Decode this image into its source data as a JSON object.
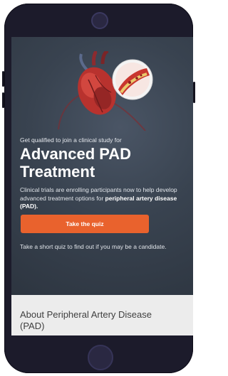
{
  "hero": {
    "eyebrow": "Get qualified to join a clinical study for",
    "title": "Advanced PAD Treatment",
    "description_prefix": "Clinical trials are enrolling participants now to help develop advanced treatment options for ",
    "description_bold": "peripheral artery disease (PAD).",
    "cta_label": "Take the quiz",
    "note": "Take a short quiz to find out if you may be a candidate."
  },
  "about": {
    "heading": "About Peripheral Artery Disease (PAD)"
  },
  "colors": {
    "hero_bg": "#394350",
    "cta": "#e9622d",
    "device": "#1c1b2b"
  },
  "icons": [
    "heart-illustration",
    "artery-cross-section"
  ]
}
